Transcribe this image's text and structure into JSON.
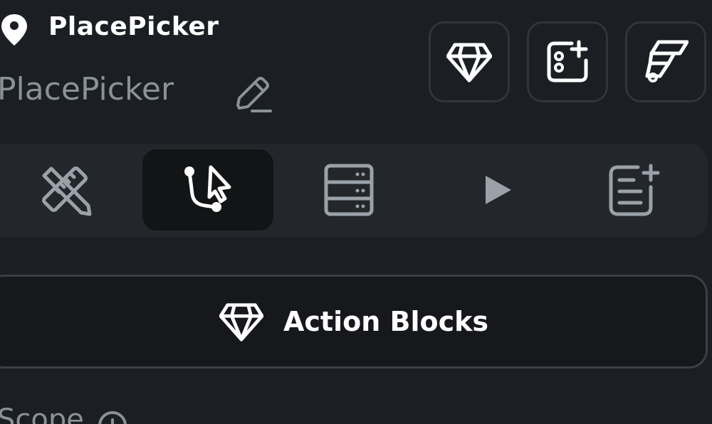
{
  "header": {
    "app_title": "PlacePicker",
    "project_name": "PlacePicker",
    "icons": {
      "location": "map-pin-icon",
      "edit": "pencil-icon"
    }
  },
  "toolbar_buttons": [
    {
      "name": "action-blocks-diamond-button",
      "icon": "diamond-icon"
    },
    {
      "name": "add-widget-button",
      "icon": "add-component-icon"
    },
    {
      "name": "flutterflow-button",
      "icon": "flutterflow-logo-icon"
    }
  ],
  "tabs": [
    {
      "name": "tab-design",
      "icon": "ruler-pencil-icon",
      "active": false
    },
    {
      "name": "tab-actions",
      "icon": "flow-cursor-icon",
      "active": true
    },
    {
      "name": "tab-data",
      "icon": "database-icon",
      "active": false
    },
    {
      "name": "tab-run",
      "icon": "play-icon",
      "active": false
    },
    {
      "name": "tab-notes",
      "icon": "add-note-icon",
      "active": false
    }
  ],
  "action_button": {
    "label": "Action Blocks",
    "icon": "diamond-icon"
  },
  "section": {
    "heading": "Scope",
    "icon": "info-icon"
  },
  "colors": {
    "background": "#1b1e22",
    "tabbar": "#23272c",
    "active_tab": "#121416",
    "muted_text": "#8a9199",
    "text": "#ffffff"
  }
}
